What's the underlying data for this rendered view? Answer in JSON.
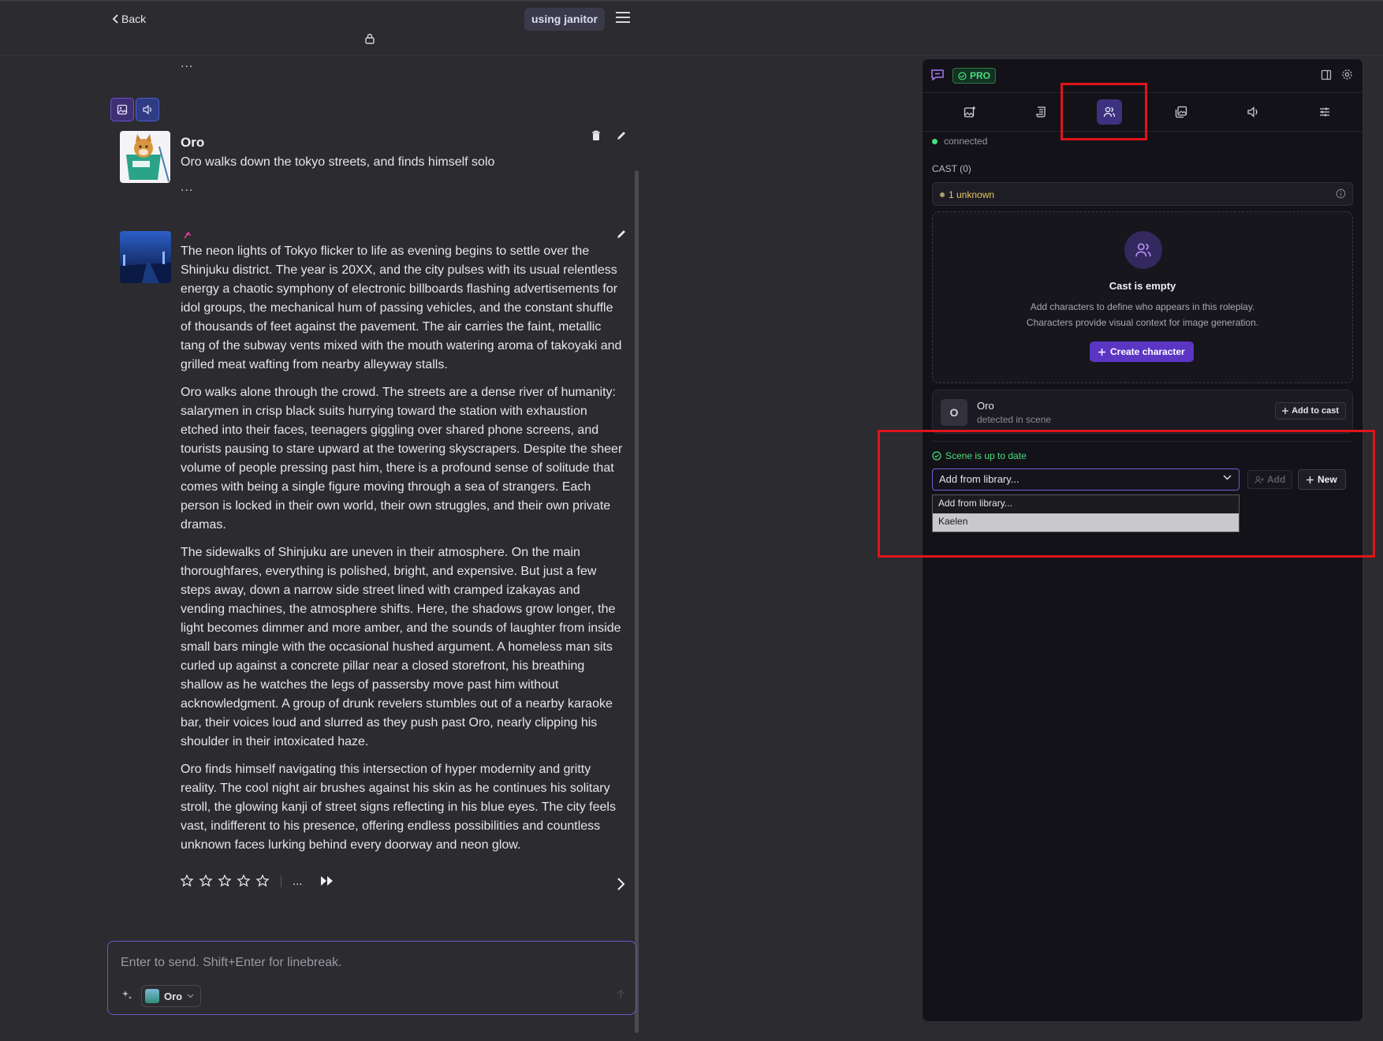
{
  "topbar": {
    "back_label": "Back",
    "janitor_label": "using janitor"
  },
  "chat": {
    "top_dots": "...",
    "character_name": "Oro",
    "first_message": "Oro walks down the tokyo streets, and finds himself solo",
    "first_message_dots": "...",
    "story_paragraphs": [
      "The neon lights of Tokyo flicker to life as evening begins to settle over the Shinjuku district. The year is 20XX, and the city pulses with its usual relentless energy a chaotic symphony of electronic billboards flashing advertisements for idol groups, the mechanical hum of passing vehicles, and the constant shuffle of thousands of feet against the pavement. The air carries the faint, metallic tang of the subway vents mixed with the mouth watering aroma of takoyaki and grilled meat wafting from nearby alleyway stalls.",
      "Oro walks alone through the crowd. The streets are a dense river of humanity: salarymen in crisp black suits hurrying toward the station with exhaustion etched into their faces, teenagers giggling over shared phone screens, and tourists pausing to stare upward at the towering skyscrapers. Despite the sheer volume of people pressing past him, there is a profound sense of solitude that comes with being a single figure moving through a sea of strangers. Each person is locked in their own world, their own struggles, and their own private dramas.",
      "The sidewalks of Shinjuku are uneven in their atmosphere. On the main thoroughfares, everything is polished, bright, and expensive. But just a few steps away, down a narrow side street lined with cramped izakayas and vending machines, the atmosphere shifts. Here, the shadows grow longer, the light becomes dimmer and more amber, and the sounds of laughter from inside small bars mingle with the occasional hushed argument. A homeless man sits curled up against a concrete pillar near a closed storefront, his breathing shallow as he watches the legs of passersby move past him without acknowledgment. A group of drunk revelers stumbles out of a nearby karaoke bar, their voices loud and slurred as they push past Oro, nearly clipping his shoulder in their intoxicated haze.",
      "Oro finds himself navigating this intersection of hyper modernity and gritty reality. The cool night air brushes against his skin as he continues his solitary stroll, the glowing kanji of street signs reflecting in his blue eyes. The city feels vast, indifferent to his presence, offering endless possibilities and countless unknown faces lurking behind every doorway and neon glow."
    ],
    "rating_dots": "...",
    "composer_placeholder": "Enter to send. Shift+Enter for linebreak.",
    "persona_name": "Oro"
  },
  "panel": {
    "pro_label": "PRO",
    "status_text": "connected",
    "cast_label": "CAST (0)",
    "unknown_label": "1 unknown",
    "empty_title": "Cast is empty",
    "empty_desc_line1": "Add characters to define who appears in this roleplay.",
    "empty_desc_line2": "Characters provide visual context for image generation.",
    "create_button": "Create character",
    "detected": {
      "initial": "O",
      "name": "Oro",
      "subtitle": "detected in scene",
      "add_to_cast": "Add to cast"
    },
    "scene_status": "Scene is up to date",
    "library_select_value": "Add from library...",
    "add_button": "Add",
    "new_button": "New",
    "dropdown_options": [
      "Add from library...",
      "Kaelen"
    ]
  },
  "colors": {
    "accent": "#5b35c4",
    "success": "#4ade80",
    "highlight": "#e0151a"
  }
}
